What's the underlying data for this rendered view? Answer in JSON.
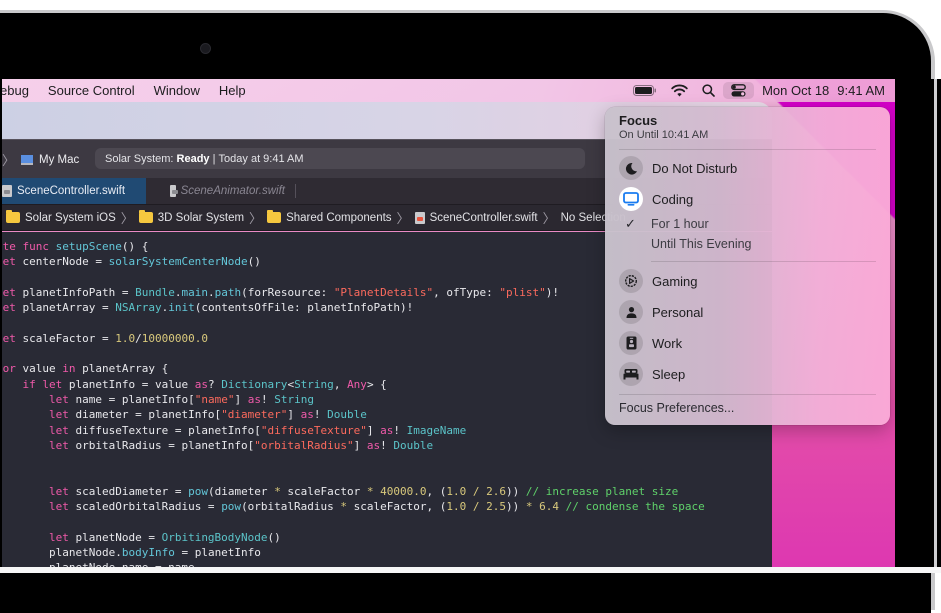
{
  "menubar": {
    "app_menus": [
      "ebug",
      "Source Control",
      "Window",
      "Help"
    ],
    "status_icons": [
      "battery-icon",
      "wifi-icon",
      "search-icon",
      "control-center-icon"
    ],
    "date": "Mon Oct 18",
    "time": "9:41 AM"
  },
  "xcode": {
    "scheme_destination": "My Mac",
    "activity": {
      "project": "Solar System:",
      "status": "Ready",
      "separator": "|",
      "timestamp": "Today at 9:41 AM"
    },
    "tabs": [
      {
        "label": "SceneController.swift",
        "active": true
      },
      {
        "label": "SceneAnimator.swift",
        "active": false
      }
    ],
    "jumpbar": [
      {
        "label": "Solar System iOS",
        "icon": "folder-icon"
      },
      {
        "label": "3D Solar System",
        "icon": "folder-icon"
      },
      {
        "label": "Shared Components",
        "icon": "folder-icon"
      },
      {
        "label": "SceneController.swift",
        "icon": "swift-file-icon"
      },
      {
        "label": "No Selection",
        "icon": ""
      }
    ],
    "code_lines": [
      [
        [
          "kw",
          "ate "
        ],
        [
          "kw",
          "func "
        ],
        [
          "fn",
          "setupScene"
        ],
        [
          "plain",
          "() {"
        ]
      ],
      [
        [
          "kw",
          "let "
        ],
        [
          "plain",
          "centerNode = "
        ],
        [
          "fn",
          "solarSystemCenterNode"
        ],
        [
          "plain",
          "()"
        ]
      ],
      [],
      [
        [
          "kw",
          "let "
        ],
        [
          "plain",
          "planetInfoPath = "
        ],
        [
          "ty",
          "Bundle"
        ],
        [
          "plain",
          "."
        ],
        [
          "fn",
          "main"
        ],
        [
          "plain",
          "."
        ],
        [
          "fn",
          "path"
        ],
        [
          "plain",
          "(forResource: "
        ],
        [
          "str",
          "\"PlanetDetails\""
        ],
        [
          "plain",
          ", ofType: "
        ],
        [
          "str",
          "\"plist\""
        ],
        [
          "plain",
          ")!"
        ]
      ],
      [
        [
          "kw",
          "let "
        ],
        [
          "plain",
          "planetArray = "
        ],
        [
          "ty",
          "NSArray"
        ],
        [
          "plain",
          "."
        ],
        [
          "fn",
          "init"
        ],
        [
          "plain",
          "(contentsOfFile: planetInfoPath)!"
        ]
      ],
      [],
      [
        [
          "kw",
          "let "
        ],
        [
          "plain",
          "scaleFactor = "
        ],
        [
          "num",
          "1.0"
        ],
        [
          "plain",
          "/"
        ],
        [
          "num",
          "10000000.0"
        ]
      ],
      [],
      [
        [
          "kw",
          "for "
        ],
        [
          "plain",
          "value "
        ],
        [
          "kw",
          "in "
        ],
        [
          "plain",
          "planetArray {"
        ]
      ],
      [
        [
          "plain",
          "    "
        ],
        [
          "kw",
          "if let "
        ],
        [
          "plain",
          "planetInfo = value "
        ],
        [
          "kw",
          "as"
        ],
        [
          "plain",
          "? "
        ],
        [
          "ty",
          "Dictionary"
        ],
        [
          "plain",
          "<"
        ],
        [
          "ty",
          "String"
        ],
        [
          "plain",
          ", "
        ],
        [
          "kw",
          "Any"
        ],
        [
          "plain",
          "> {"
        ]
      ],
      [
        [
          "plain",
          "        "
        ],
        [
          "kw",
          "let "
        ],
        [
          "plain",
          "name = planetInfo["
        ],
        [
          "str",
          "\"name\""
        ],
        [
          "plain",
          "] "
        ],
        [
          "kw",
          "as"
        ],
        [
          "plain",
          "! "
        ],
        [
          "ty",
          "String"
        ]
      ],
      [
        [
          "plain",
          "        "
        ],
        [
          "kw",
          "let "
        ],
        [
          "plain",
          "diameter = planetInfo["
        ],
        [
          "str",
          "\"diameter\""
        ],
        [
          "plain",
          "] "
        ],
        [
          "kw",
          "as"
        ],
        [
          "plain",
          "! "
        ],
        [
          "ty",
          "Double"
        ]
      ],
      [
        [
          "plain",
          "        "
        ],
        [
          "kw",
          "let "
        ],
        [
          "plain",
          "diffuseTexture = planetInfo["
        ],
        [
          "str",
          "\"diffuseTexture\""
        ],
        [
          "plain",
          "] "
        ],
        [
          "kw",
          "as"
        ],
        [
          "plain",
          "! "
        ],
        [
          "ty",
          "ImageName"
        ]
      ],
      [
        [
          "plain",
          "        "
        ],
        [
          "kw",
          "let "
        ],
        [
          "plain",
          "orbitalRadius = planetInfo["
        ],
        [
          "str",
          "\"orbitalRadius\""
        ],
        [
          "plain",
          "] "
        ],
        [
          "kw",
          "as"
        ],
        [
          "plain",
          "! "
        ],
        [
          "ty",
          "Double"
        ]
      ],
      [],
      [],
      [
        [
          "plain",
          "        "
        ],
        [
          "kw",
          "let "
        ],
        [
          "plain",
          "scaledDiameter = "
        ],
        [
          "fn",
          "pow"
        ],
        [
          "plain",
          "(diameter "
        ],
        [
          "num",
          "*"
        ],
        [
          "plain",
          " scaleFactor "
        ],
        [
          "num",
          "*"
        ],
        [
          "plain",
          " "
        ],
        [
          "num",
          "40000.0"
        ],
        [
          "plain",
          ", ("
        ],
        [
          "num",
          "1.0"
        ],
        [
          "plain",
          " "
        ],
        [
          "num",
          "/"
        ],
        [
          "plain",
          " "
        ],
        [
          "num",
          "2.6"
        ],
        [
          "plain",
          "))"
        ],
        [
          "cm",
          " // increase planet size"
        ]
      ],
      [
        [
          "plain",
          "        "
        ],
        [
          "kw",
          "let "
        ],
        [
          "plain",
          "scaledOrbitalRadius = "
        ],
        [
          "fn",
          "pow"
        ],
        [
          "plain",
          "(orbitalRadius "
        ],
        [
          "num",
          "*"
        ],
        [
          "plain",
          " scaleFactor, ("
        ],
        [
          "num",
          "1.0"
        ],
        [
          "plain",
          " "
        ],
        [
          "num",
          "/"
        ],
        [
          "plain",
          " "
        ],
        [
          "num",
          "2.5"
        ],
        [
          "plain",
          ")) "
        ],
        [
          "num",
          "*"
        ],
        [
          "plain",
          " "
        ],
        [
          "num",
          "6.4"
        ],
        [
          "cm",
          " // condense the space"
        ]
      ],
      [],
      [
        [
          "plain",
          "        "
        ],
        [
          "kw",
          "let "
        ],
        [
          "plain",
          "planetNode = "
        ],
        [
          "ty",
          "OrbitingBodyNode"
        ],
        [
          "plain",
          "()"
        ]
      ],
      [
        [
          "plain",
          "        planetNode."
        ],
        [
          "fn",
          "bodyInfo"
        ],
        [
          "plain",
          " = planetInfo"
        ]
      ],
      [
        [
          "plain",
          "        planetNode.name = name"
        ]
      ]
    ]
  },
  "focus": {
    "title": "Focus",
    "subtitle": "On Until 10:41 AM",
    "modes": [
      {
        "label": "Do Not Disturb",
        "icon": "moon-icon",
        "active": false
      },
      {
        "label": "Coding",
        "icon": "monitor-icon",
        "active": true
      },
      {
        "label": "Gaming",
        "icon": "gaming-icon",
        "active": false
      },
      {
        "label": "Personal",
        "icon": "person-icon",
        "active": false
      },
      {
        "label": "Work",
        "icon": "work-badge-icon",
        "active": false
      },
      {
        "label": "Sleep",
        "icon": "bed-icon",
        "active": false
      }
    ],
    "duration_options": [
      {
        "label": "For 1 hour",
        "selected": true
      },
      {
        "label": "Until This Evening",
        "selected": false
      }
    ],
    "preferences_label": "Focus Preferences..."
  },
  "colors": {
    "accent_blue": "#1a7cf0",
    "active_tab": "#204a73",
    "editor_bg": "#292a35",
    "keyword": "#f05aaa",
    "string": "#fc6a5d",
    "comment": "#5fd16a"
  }
}
